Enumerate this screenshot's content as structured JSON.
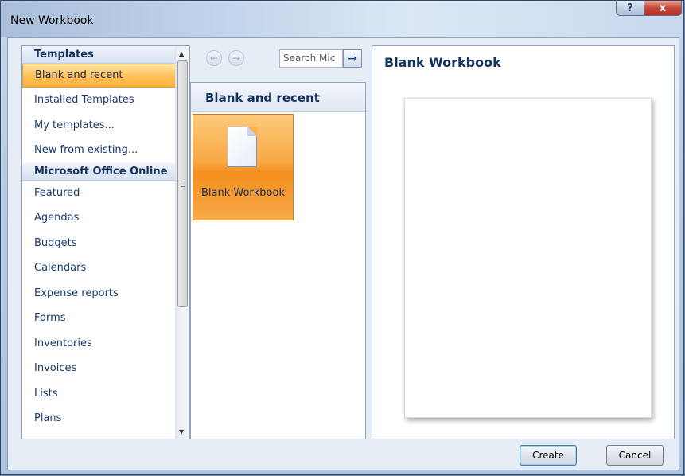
{
  "window": {
    "title": "New Workbook",
    "help_label": "?",
    "close_label": "x"
  },
  "sidebar": {
    "groups": [
      {
        "header": "Templates",
        "items": [
          "Blank and recent",
          "Installed Templates",
          "My templates...",
          "New from existing..."
        ]
      },
      {
        "header": "Microsoft Office Online",
        "items": [
          "Featured",
          "Agendas",
          "Budgets",
          "Calendars",
          "Expense reports",
          "Forms",
          "Inventories",
          "Invoices",
          "Lists",
          "Plans"
        ]
      }
    ],
    "selected": "Blank and recent"
  },
  "nav": {
    "back_glyph": "←",
    "forward_glyph": "→",
    "search_placeholder": "Search Mic",
    "go_glyph": "→"
  },
  "middle": {
    "header": "Blank and recent",
    "tile_label": "Blank Workbook"
  },
  "preview": {
    "title": "Blank Workbook"
  },
  "buttons": {
    "create": "Create",
    "cancel": "Cancel"
  },
  "scroll": {
    "up": "▲",
    "down": "▼"
  }
}
